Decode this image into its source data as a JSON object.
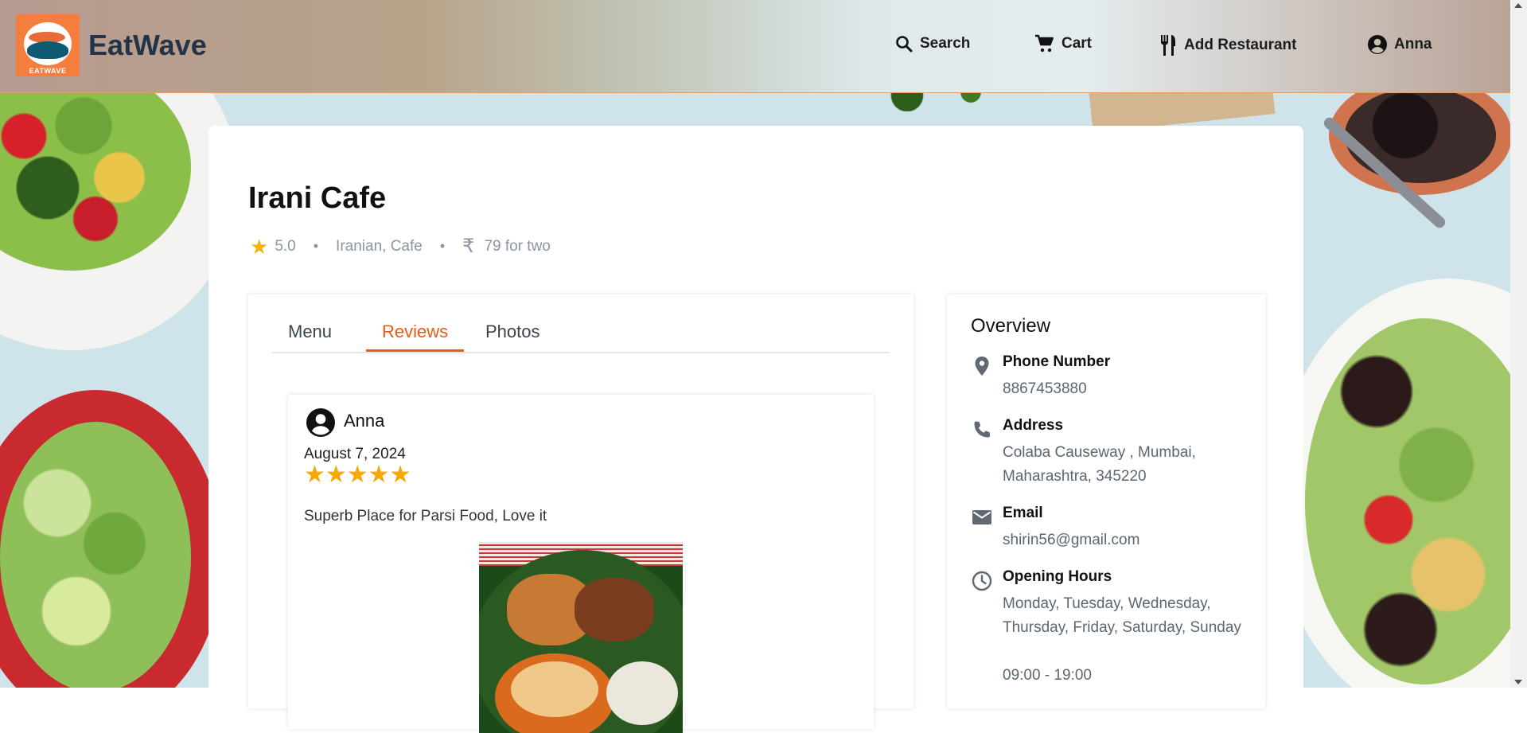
{
  "header": {
    "logo_text": "EATWAVE",
    "brand": "EatWave",
    "nav": {
      "search": "Search",
      "cart": "Cart",
      "add_restaurant": "Add Restaurant",
      "user": "Anna"
    }
  },
  "restaurant": {
    "name": "Irani Cafe",
    "rating": "5.0",
    "cuisines": "Iranian, Cafe",
    "rupee_symbol": "₹",
    "cost": "79 for two",
    "separator": "•"
  },
  "tabs": [
    {
      "label": "Menu",
      "active": false
    },
    {
      "label": "Reviews",
      "active": true
    },
    {
      "label": "Photos",
      "active": false
    }
  ],
  "review": {
    "reviewer": "Anna",
    "date": "August 7, 2024",
    "stars": 5,
    "star_glyphs": "★★★★★",
    "text": "Superb Place for Parsi Food, Love it"
  },
  "overview": {
    "title": "Overview",
    "phone_label": "Phone Number",
    "phone_value": "8867453880",
    "address_label": "Address",
    "address_value": "Colaba Causeway , Mumbai, Maharashtra, 345220",
    "email_label": "Email",
    "email_value": "shirin56@gmail.com",
    "hours_label": "Opening Hours",
    "hours_days": "Monday, Tuesday, Wednesday, Thursday, Friday, Saturday, Sunday",
    "hours_time": "09:00 - 19:00"
  },
  "colors": {
    "accent": "#ec5a16",
    "star": "#f5a800",
    "header_border": "#e79c61",
    "brand": "#243448"
  }
}
